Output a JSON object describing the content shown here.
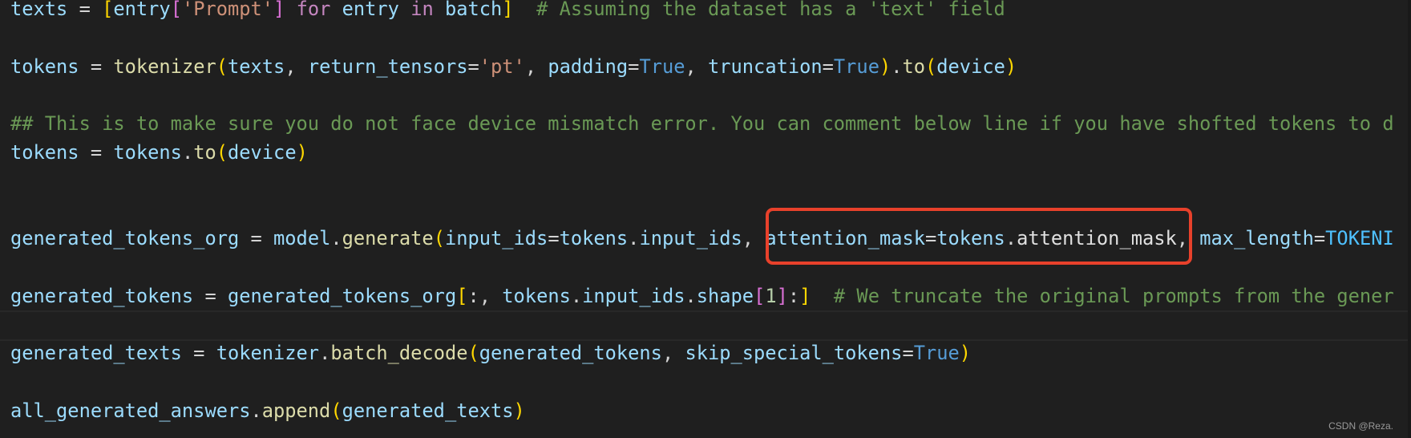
{
  "colors": {
    "background": "#1f1f1f",
    "highlight_box": "#e8412b"
  },
  "code_lines": [
    {
      "index": 0,
      "tokens": [
        [
          "texts",
          "v"
        ],
        [
          " = ",
          "o"
        ],
        [
          "[",
          "b1"
        ],
        [
          "entry",
          "v"
        ],
        [
          "[",
          "b2"
        ],
        [
          "'Prompt'",
          "s"
        ],
        [
          "]",
          "b2"
        ],
        [
          " for ",
          "k"
        ],
        [
          "entry",
          "v"
        ],
        [
          " in ",
          "k"
        ],
        [
          "batch",
          "v"
        ],
        [
          "]",
          "b1"
        ],
        [
          "  # Assuming the dataset has a 'text' field",
          "c"
        ]
      ]
    },
    {
      "index": 2,
      "tokens": [
        [
          "tokens",
          "v"
        ],
        [
          " = ",
          "o"
        ],
        [
          "tokenizer",
          "f"
        ],
        [
          "(",
          "b1"
        ],
        [
          "texts",
          "v"
        ],
        [
          ", ",
          "o"
        ],
        [
          "return_tensors",
          "v"
        ],
        [
          "=",
          "o"
        ],
        [
          "'pt'",
          "s"
        ],
        [
          ", ",
          "o"
        ],
        [
          "padding",
          "v"
        ],
        [
          "=",
          "o"
        ],
        [
          "True",
          "t"
        ],
        [
          ", ",
          "o"
        ],
        [
          "truncation",
          "v"
        ],
        [
          "=",
          "o"
        ],
        [
          "True",
          "t"
        ],
        [
          ")",
          "b1"
        ],
        [
          ".",
          "o"
        ],
        [
          "to",
          "f"
        ],
        [
          "(",
          "b1"
        ],
        [
          "device",
          "v"
        ],
        [
          ")",
          "b1"
        ]
      ]
    },
    {
      "index": 4,
      "tokens": [
        [
          "## This is to make sure you do not face device mismatch error. You can comment below line if you have shofted tokens to d",
          "c"
        ]
      ]
    },
    {
      "index": 5,
      "tokens": [
        [
          "tokens",
          "v"
        ],
        [
          " = ",
          "o"
        ],
        [
          "tokens",
          "v"
        ],
        [
          ".",
          "o"
        ],
        [
          "to",
          "f"
        ],
        [
          "(",
          "b1"
        ],
        [
          "device",
          "v"
        ],
        [
          ")",
          "b1"
        ]
      ]
    },
    {
      "index": 8,
      "tokens": [
        [
          "generated_tokens_org",
          "v"
        ],
        [
          " = ",
          "o"
        ],
        [
          "model",
          "v"
        ],
        [
          ".",
          "o"
        ],
        [
          "generate",
          "f"
        ],
        [
          "(",
          "b1"
        ],
        [
          "input_ids",
          "v"
        ],
        [
          "=",
          "o"
        ],
        [
          "tokens",
          "v"
        ],
        [
          ".",
          "o"
        ],
        [
          "input_ids",
          "v"
        ],
        [
          ", ",
          "o"
        ],
        [
          "attention_mask",
          "v"
        ],
        [
          "=",
          "o"
        ],
        [
          "tokens",
          "v"
        ],
        [
          ".",
          "o"
        ],
        [
          "attention_mask",
          "w"
        ],
        [
          ", ",
          "o"
        ],
        [
          "max_length",
          "v"
        ],
        [
          "=",
          "o"
        ],
        [
          "TOKENI",
          "C"
        ]
      ]
    },
    {
      "index": 10,
      "tokens": [
        [
          "generated_tokens",
          "v"
        ],
        [
          " = ",
          "o"
        ],
        [
          "generated_tokens_org",
          "v"
        ],
        [
          "[",
          "b1"
        ],
        [
          ":, ",
          "o"
        ],
        [
          "tokens",
          "v"
        ],
        [
          ".",
          "o"
        ],
        [
          "input_ids",
          "v"
        ],
        [
          ".",
          "o"
        ],
        [
          "shape",
          "v"
        ],
        [
          "[",
          "b2"
        ],
        [
          "1",
          "n"
        ],
        [
          "]",
          "b2"
        ],
        [
          ":",
          "o"
        ],
        [
          "]",
          "b1"
        ],
        [
          "  # We truncate the original prompts from the gener",
          "c"
        ]
      ]
    },
    {
      "index": 12,
      "tokens": [
        [
          "generated_texts",
          "v"
        ],
        [
          " = ",
          "o"
        ],
        [
          "tokenizer",
          "v"
        ],
        [
          ".",
          "o"
        ],
        [
          "batch_decode",
          "f"
        ],
        [
          "(",
          "b1"
        ],
        [
          "generated_tokens",
          "v"
        ],
        [
          ", ",
          "o"
        ],
        [
          "skip_special_tokens",
          "v"
        ],
        [
          "=",
          "o"
        ],
        [
          "True",
          "t"
        ],
        [
          ")",
          "b1"
        ]
      ]
    },
    {
      "index": 14,
      "tokens": [
        [
          "all_generated_answers",
          "v"
        ],
        [
          ".",
          "o"
        ],
        [
          "append",
          "f"
        ],
        [
          "(",
          "b1"
        ],
        [
          "generated_texts",
          "v"
        ],
        [
          ")",
          "b1"
        ]
      ]
    }
  ],
  "watermark": "CSDN @Reza."
}
